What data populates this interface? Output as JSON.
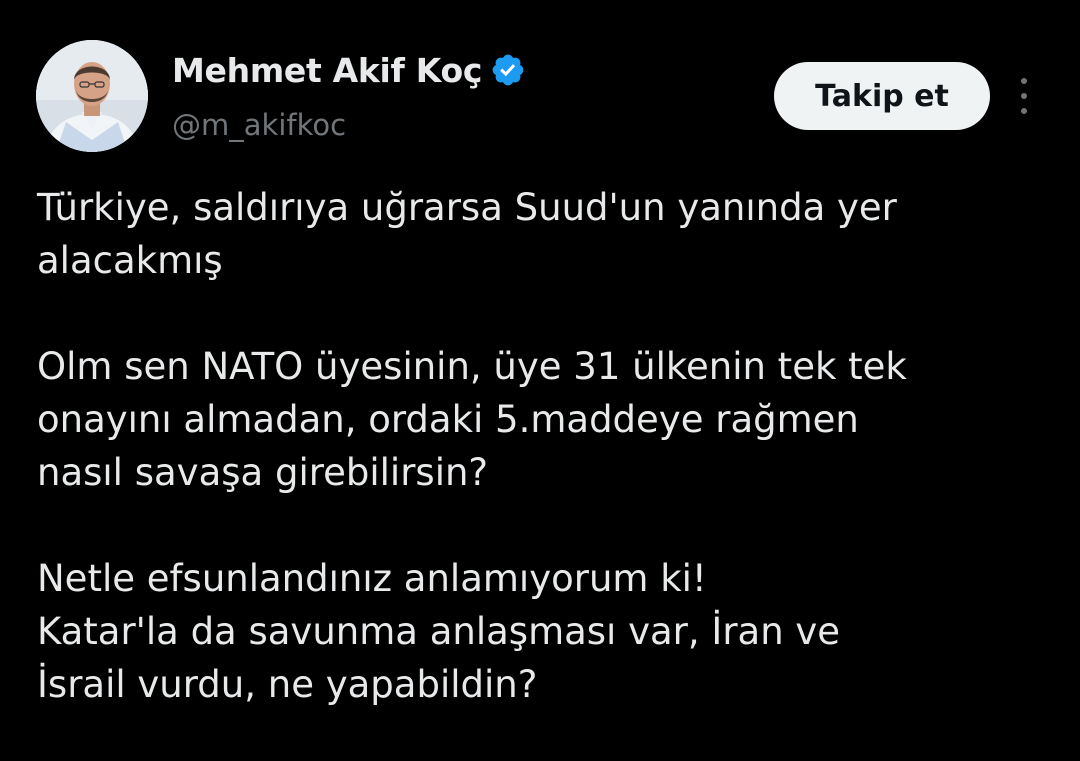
{
  "author": {
    "display_name": "Mehmet Akif Koç",
    "handle": "@m_akifkoc",
    "verified": true,
    "avatar_icon": "user-avatar-photo",
    "verified_icon": "verified-badge-icon"
  },
  "actions": {
    "follow_label": "Takip et",
    "more_icon": "more-vertical-icon"
  },
  "tweet": {
    "lines": [
      "Türkiye, saldırıya uğrarsa Suud'un yanında yer",
      "alacakmış",
      "",
      "Olm sen NATO üyesinin, üye 31 ülkenin tek tek",
      "onayını almadan, ordaki 5.maddeye rağmen",
      "nasıl savaşa girebilirsin?",
      "",
      "Netle efsunlandınız anlamıyorum ki!",
      "Katar'la da savunma anlaşması var, İran ve",
      "İsrail vurdu, ne yapabildin?"
    ]
  },
  "colors": {
    "background": "#000000",
    "text_primary": "#e7e9ea",
    "text_secondary": "#71767b",
    "verified_blue": "#1d9bf0",
    "button_bg": "#eff3f4",
    "button_text": "#0f1419"
  }
}
